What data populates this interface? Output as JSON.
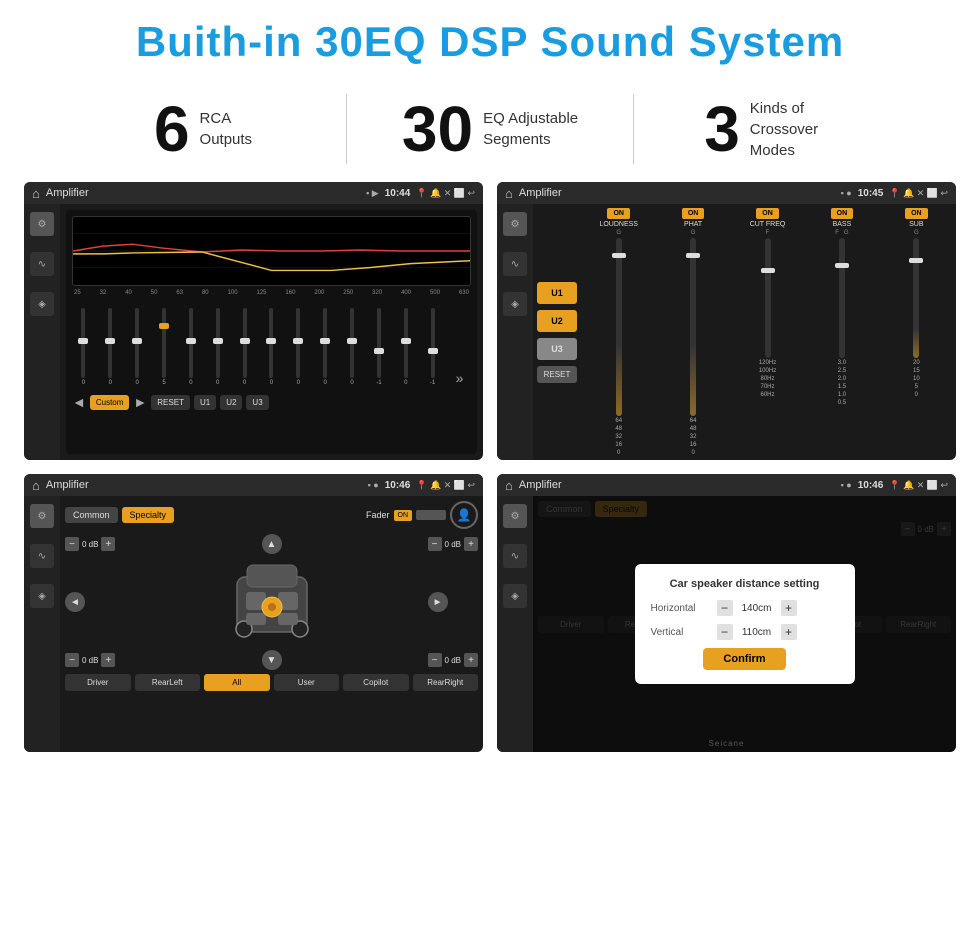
{
  "header": {
    "title": "Buith-in 30EQ DSP Sound System"
  },
  "stats": [
    {
      "number": "6",
      "label": "RCA\nOutputs"
    },
    {
      "number": "30",
      "label": "EQ Adjustable\nSegments"
    },
    {
      "number": "3",
      "label": "Kinds of\nCrossover Modes"
    }
  ],
  "screens": [
    {
      "id": "eq-screen",
      "title": "Amplifier",
      "time": "10:44",
      "type": "eq"
    },
    {
      "id": "crossover-screen",
      "title": "Amplifier",
      "time": "10:45",
      "type": "crossover"
    },
    {
      "id": "speaker-screen",
      "title": "Amplifier",
      "time": "10:46",
      "type": "speaker"
    },
    {
      "id": "distance-screen",
      "title": "Amplifier",
      "time": "10:46",
      "type": "distance"
    }
  ],
  "eq": {
    "freqs": [
      "25",
      "32",
      "40",
      "50",
      "63",
      "80",
      "100",
      "125",
      "160",
      "200",
      "250",
      "320",
      "400",
      "500",
      "630"
    ],
    "values": [
      "0",
      "0",
      "0",
      "5",
      "0",
      "0",
      "0",
      "0",
      "0",
      "0",
      "0",
      "-1",
      "0",
      "-1"
    ],
    "buttons": [
      "Custom",
      "RESET",
      "U1",
      "U2",
      "U3"
    ]
  },
  "crossover": {
    "units": [
      "U1",
      "U2",
      "U3"
    ],
    "channels": [
      {
        "label": "LOUDNESS",
        "on": true
      },
      {
        "label": "PHAT",
        "on": true
      },
      {
        "label": "CUT FREQ",
        "on": true
      },
      {
        "label": "BASS",
        "on": true
      },
      {
        "label": "SUB",
        "on": true
      }
    ],
    "resetLabel": "RESET"
  },
  "speaker": {
    "tabs": [
      "Common",
      "Specialty"
    ],
    "activeTab": "Specialty",
    "faderLabel": "Fader",
    "faderOn": "ON",
    "dbValues": [
      "0 dB",
      "0 dB",
      "0 dB",
      "0 dB"
    ],
    "buttons": [
      "Driver",
      "RearLeft",
      "All",
      "User",
      "Copilot",
      "RearRight"
    ]
  },
  "distance": {
    "tabs": [
      "Common",
      "Specialty"
    ],
    "dialogTitle": "Car speaker distance setting",
    "horizontal": {
      "label": "Horizontal",
      "value": "140cm"
    },
    "vertical": {
      "label": "Vertical",
      "value": "110cm"
    },
    "confirmLabel": "Confirm",
    "buttons": [
      "Driver",
      "RearLeft",
      "All",
      "User",
      "Copilot",
      "RearRight"
    ],
    "dbRight": "0 dB"
  },
  "watermark": "Seicane"
}
